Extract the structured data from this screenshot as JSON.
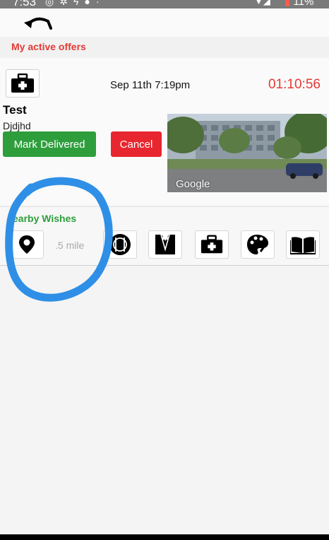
{
  "status_bar": {
    "time": "7:53",
    "battery": "11%",
    "icons": [
      "whatsapp-icon",
      "sun-icon",
      "lightning-icon",
      "circle-icon",
      "dot-icon",
      "wifi-icon",
      "signal-icon",
      "battery-icon"
    ]
  },
  "nav": {
    "back_icon": "undo-arrow-icon"
  },
  "active_offers": {
    "header": "My active offers",
    "offer": {
      "category_icon": "medical-kit-icon",
      "date": "Sep 11th 7:19pm",
      "timer": "01:10:56",
      "title": "Test",
      "subtitle": "Djdjhd",
      "mark_delivered_label": "Mark Delivered",
      "cancel_label": "Cancel",
      "map_attribution": "Google"
    }
  },
  "nearby_wishes": {
    "title": "earby Wishes",
    "distance_placeholder": ".5 mile",
    "categories": [
      "location-pin-icon",
      "food-icon",
      "tuxedo-icon",
      "medical-kit-icon",
      "palette-icon",
      "book-icon"
    ]
  },
  "colors": {
    "accent_red": "#e53935",
    "accent_green": "#2e9e3c",
    "annotation_blue": "#2f8fe6"
  }
}
